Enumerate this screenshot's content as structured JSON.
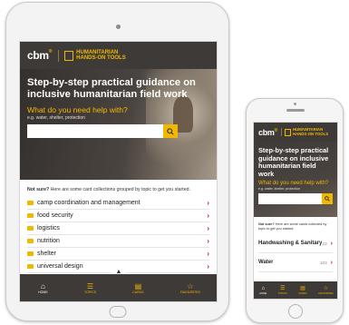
{
  "brand": {
    "cbm": "cbm",
    "tool_line1": "HUMANITARIAN",
    "tool_line2": "HANDS-ON TOOLS"
  },
  "hero": {
    "title": "Step-by-step practical guidance on inclusive humanitarian field work",
    "question": "What do you need help with?",
    "hint": "e.g. water, shelter, protection",
    "search_value": "",
    "search_placeholder": ""
  },
  "tablet": {
    "note_bold": "Not sure?",
    "note_text": " Here are some card collections grouped by topic to get you started.",
    "collections": [
      {
        "label": "camp coordination and management"
      },
      {
        "label": "food security"
      },
      {
        "label": "logistics"
      },
      {
        "label": "nutrition"
      },
      {
        "label": "shelter"
      },
      {
        "label": "universal design"
      }
    ],
    "nav": [
      {
        "label": "HOME"
      },
      {
        "label": "TOPICS"
      },
      {
        "label": "CARDS"
      },
      {
        "label": "FAVOURITES"
      }
    ]
  },
  "phone": {
    "title": "Step-by-step practical guidance on inclusive humanitarian field work",
    "question": "What do you need help with?",
    "hint": "e.g. water, shelter, protection",
    "note_bold": "Not sure?",
    "note_text": " Here are some cards collected by topic to get you started.",
    "collections": [
      {
        "label": "Handwashing & Sanitary",
        "count": "23"
      },
      {
        "label": "Water",
        "count": "103"
      }
    ],
    "nav": [
      {
        "label": "HOME"
      },
      {
        "label": "TOPICS"
      },
      {
        "label": "CARDS"
      },
      {
        "label": "FAVOURITES"
      }
    ]
  },
  "colors": {
    "header_bg": "#3e3a37",
    "accent_yellow": "#f2b800",
    "chevron_red": "#c4152b"
  },
  "icons": {
    "search": "search-icon",
    "folder": "folder-icon",
    "chevron": "chevron-right-icon",
    "up": "chevron-up-icon",
    "home": "home-icon",
    "topics": "list-icon",
    "cards": "card-icon",
    "favourites": "star-icon"
  }
}
